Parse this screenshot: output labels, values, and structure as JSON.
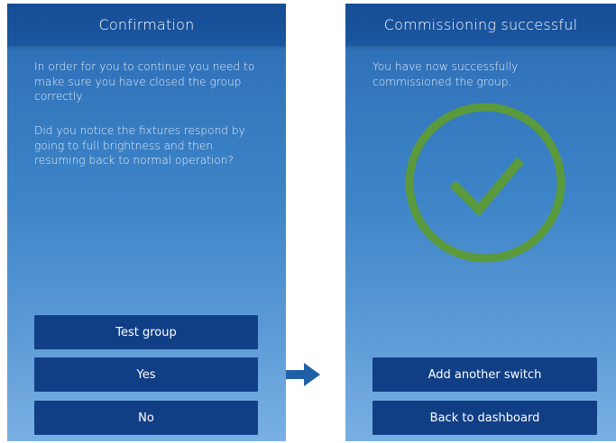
{
  "left_screen": {
    "title": "Confirmation",
    "paragraph1": "In order for you to continue you need to make sure you have closed the group correctly.",
    "paragraph2": "Did you notice the fixtures respond by going to full brightness and then resuming back to normal operation?",
    "buttons": {
      "test_group": "Test group",
      "yes": "Yes",
      "no": "No"
    }
  },
  "right_screen": {
    "title": "Commissioning successful",
    "paragraph": "You have now successfully commissioned the group.",
    "success_icon": "checkmark-circle-icon",
    "buttons": {
      "add_another_switch": "Add another switch",
      "back_to_dashboard": "Back to dashboard"
    }
  },
  "transition_icon": "right-arrow-icon",
  "colors": {
    "header": "#164d95",
    "button": "#113f86",
    "screen_top": "#2c6bb4",
    "screen_bottom": "#79b0e3",
    "success_green": "#5a9a3c",
    "arrow": "#1f5fa6"
  }
}
